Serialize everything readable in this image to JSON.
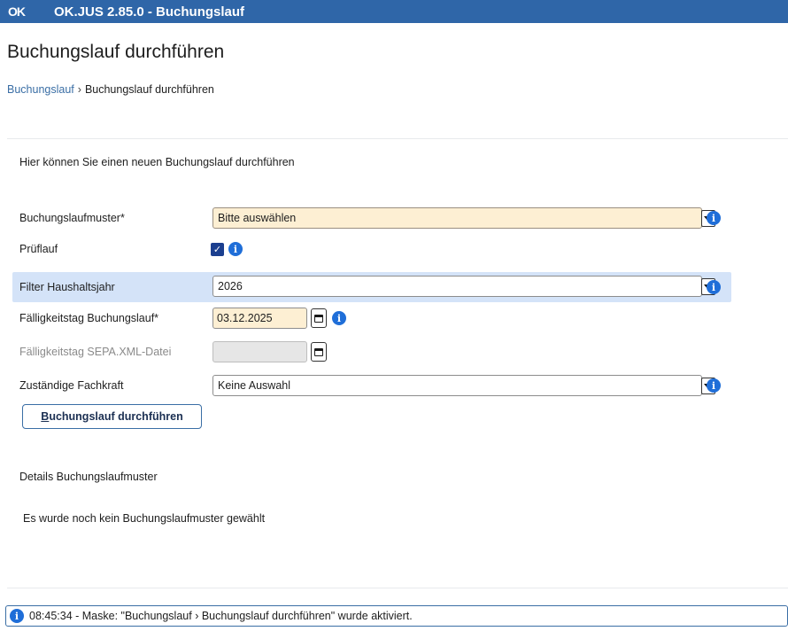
{
  "window": {
    "logo_text": "OK",
    "title": "OK.JUS 2.85.0 - Buchungslauf"
  },
  "page": {
    "title": "Buchungslauf durchführen",
    "breadcrumb": {
      "parent": "Buchungslauf",
      "separator": "›",
      "current": "Buchungslauf durchführen"
    },
    "intro": "Hier können Sie einen neuen Buchungslauf durchführen"
  },
  "form": {
    "buchungslaufmuster": {
      "label": "Buchungslaufmuster*",
      "value": "Bitte auswählen"
    },
    "prueflauf": {
      "label": "Prüflauf",
      "checked": true,
      "check_glyph": "✓"
    },
    "filter_haushaltsjahr": {
      "label": "Filter Haushaltsjahr",
      "value": "2026"
    },
    "faelligkeitstag_buchungslauf": {
      "label": "Fälligkeitstag Buchungslauf*",
      "value": "03.12.2025"
    },
    "faelligkeitstag_sepa": {
      "label": "Fälligkeitstag SEPA.XML-Datei",
      "value": ""
    },
    "zustaendige_fachkraft": {
      "label": "Zuständige Fachkraft",
      "value": "Keine Auswahl"
    },
    "info_glyph": "i",
    "submit": {
      "accesskey_letter": "B",
      "label_rest": "uchungslauf durchführen"
    }
  },
  "details": {
    "heading": "Details Buchungslaufmuster",
    "text": "Es wurde noch kein Buchungslaufmuster gewählt"
  },
  "status": {
    "message": "08:45:34 - Maske: \"Buchungslauf › Buchungslauf durchführen\" wurde aktiviert."
  },
  "colors": {
    "titlebar": "#2f66a8",
    "accent": "#1f6ed8",
    "required_field": "#fdefd3",
    "highlight_row": "#d4e3f8"
  }
}
